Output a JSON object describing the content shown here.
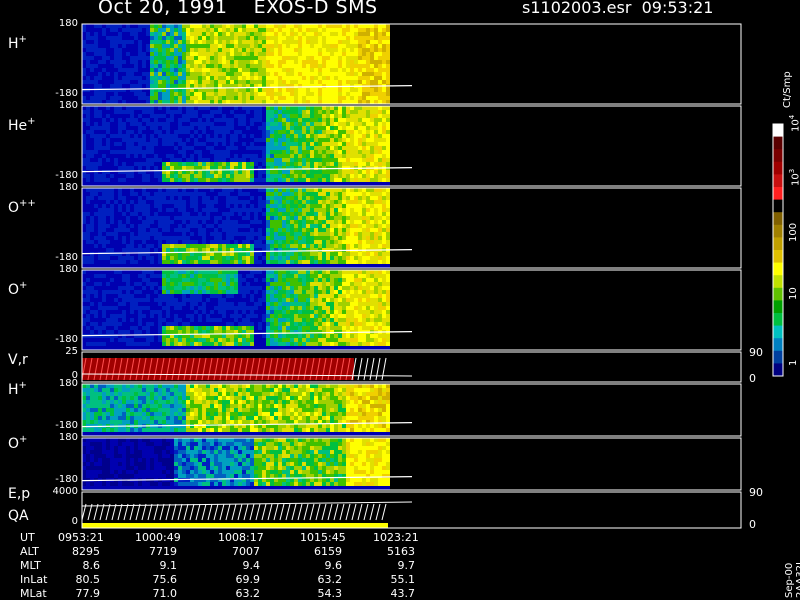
{
  "header": {
    "title": "Oct 20, 1991    EXOS-D SMS",
    "file_time": "s1102003.esr  09:53:21"
  },
  "panels": [
    {
      "id": "hplus1",
      "label_main": "H",
      "label_sup": "+",
      "y_top": "180",
      "y_bottom": "-180"
    },
    {
      "id": "heplus",
      "label_main": "He",
      "label_sup": "+",
      "y_top": "180",
      "y_bottom": "-180"
    },
    {
      "id": "oplusplus",
      "label_main": "O",
      "label_sup": "++",
      "y_top": "180",
      "y_bottom": "-180"
    },
    {
      "id": "oplus1",
      "label_main": "O",
      "label_sup": "+",
      "y_top": "180",
      "y_bottom": "-180"
    },
    {
      "id": "vr",
      "label_main": "V,r",
      "label_sup": "",
      "y_top": "25",
      "y_bottom": "0",
      "right_top": "90",
      "right_bottom": "0"
    },
    {
      "id": "hplus2",
      "label_main": "H",
      "label_sup": "+",
      "y_top": "180",
      "y_bottom": "-180"
    },
    {
      "id": "oplus2",
      "label_main": "O",
      "label_sup": "+",
      "y_top": "180",
      "y_bottom": "-180"
    },
    {
      "id": "ep",
      "label_main": "E,p",
      "label_sup": "",
      "label2": "QA",
      "y_top": "4000",
      "y_bottom": "0",
      "right_top": "90",
      "right_bottom": "0"
    }
  ],
  "colorbar": {
    "label": "Ct/Smp",
    "tick_labels": [
      "10",
      "10",
      "100",
      "10",
      "1"
    ],
    "tick_sups": [
      "4",
      "3",
      "",
      "",
      ""
    ],
    "stamp": "Sep-00  2AA32L",
    "colors": [
      "#ffffff",
      "#5a0000",
      "#7a0000",
      "#a00000",
      "#c81010",
      "#ff2020",
      "#000000",
      "#806000",
      "#a08000",
      "#c0a000",
      "#e0c000",
      "#ffff00",
      "#c0e000",
      "#60c000",
      "#00a000",
      "#00c040",
      "#00c0c0",
      "#0080c0",
      "#0040a0",
      "#000080"
    ]
  },
  "footer": {
    "rows": [
      {
        "name": "UT",
        "values": [
          "0953:21",
          "1000:49",
          "1008:17",
          "1015:45",
          "1023:21"
        ]
      },
      {
        "name": "ALT",
        "values": [
          "8295",
          "7719",
          "7007",
          "6159",
          "5163"
        ]
      },
      {
        "name": "MLT",
        "values": [
          "8.6",
          "9.1",
          "9.4",
          "9.6",
          "9.7"
        ]
      },
      {
        "name": "InLat",
        "values": [
          "80.5",
          "75.6",
          "69.9",
          "63.2",
          "55.1"
        ]
      },
      {
        "name": "MLat",
        "values": [
          "77.9",
          "71.0",
          "63.2",
          "54.3",
          "43.7"
        ]
      }
    ]
  },
  "chart_data": {
    "type": "heatmap",
    "title": "Oct 20, 1991    EXOS-D SMS",
    "x_ticks": [
      "0953:21",
      "1000:49",
      "1008:17",
      "1015:45",
      "1023:21"
    ],
    "colorbar_unit": "Ct/Smp",
    "colorbar_ticks": [
      "1",
      "10",
      "100",
      "10^3",
      "10^4"
    ],
    "panels": [
      "H+",
      "He+",
      "O++",
      "O+",
      "V,r",
      "H+",
      "O+",
      "E,p / QA"
    ]
  }
}
